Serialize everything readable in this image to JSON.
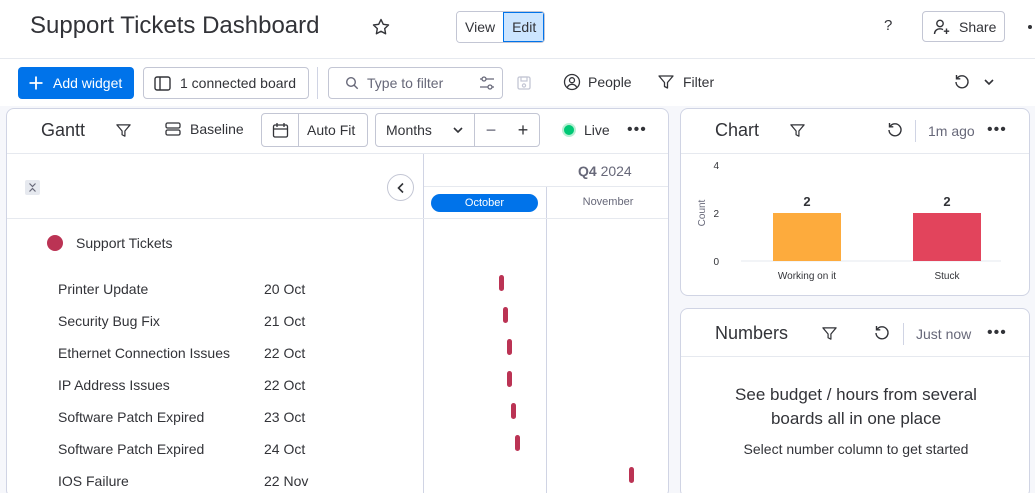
{
  "header": {
    "title": "Support Tickets Dashboard",
    "view_label": "View",
    "edit_label": "Edit",
    "help_label": "?",
    "share_label": "Share"
  },
  "toolbar": {
    "add_widget_label": "Add widget",
    "connected_label": "1 connected board",
    "filter_placeholder": "Type to filter",
    "people_label": "People",
    "filter_label": "Filter"
  },
  "gantt": {
    "title": "Gantt",
    "baseline_label": "Baseline",
    "autofit_label": "Auto Fit",
    "zoom_select": "Months",
    "zoom_minus": "−",
    "zoom_plus": "+",
    "live_label": "Live",
    "quarter_bold": "Q4",
    "quarter_year": "2024",
    "month_1": "October",
    "month_2": "November",
    "group_name": "Support Tickets",
    "group_color": "#bb3354",
    "items": [
      {
        "name": "Printer Update",
        "date": "20 Oct",
        "day_index": 19
      },
      {
        "name": "Security Bug Fix",
        "date": "21 Oct",
        "day_index": 20
      },
      {
        "name": "Ethernet Connection Issues",
        "date": "22 Oct",
        "day_index": 21
      },
      {
        "name": "IP Address Issues",
        "date": "22 Oct",
        "day_index": 21
      },
      {
        "name": "Software Patch Expired",
        "date": "23 Oct",
        "day_index": 22
      },
      {
        "name": "Software Patch Expired",
        "date": "24 Oct",
        "day_index": 23
      },
      {
        "name": "IOS Failure",
        "date": "22 Nov",
        "day_index": 52
      }
    ]
  },
  "chart_widget": {
    "title": "Chart",
    "updated": "1m ago"
  },
  "chart_data": {
    "type": "bar",
    "categories": [
      "Working on it",
      "Stuck"
    ],
    "values": [
      2,
      2
    ],
    "colors": [
      "#fdab3d",
      "#e2445c"
    ],
    "ylabel": "Count",
    "ylim": [
      0,
      4
    ],
    "yticks": [
      0,
      2,
      4
    ]
  },
  "numbers_widget": {
    "title": "Numbers",
    "updated": "Just now",
    "headline": "See budget / hours from several boards all in one place",
    "subtext": "Select number column to get started"
  }
}
